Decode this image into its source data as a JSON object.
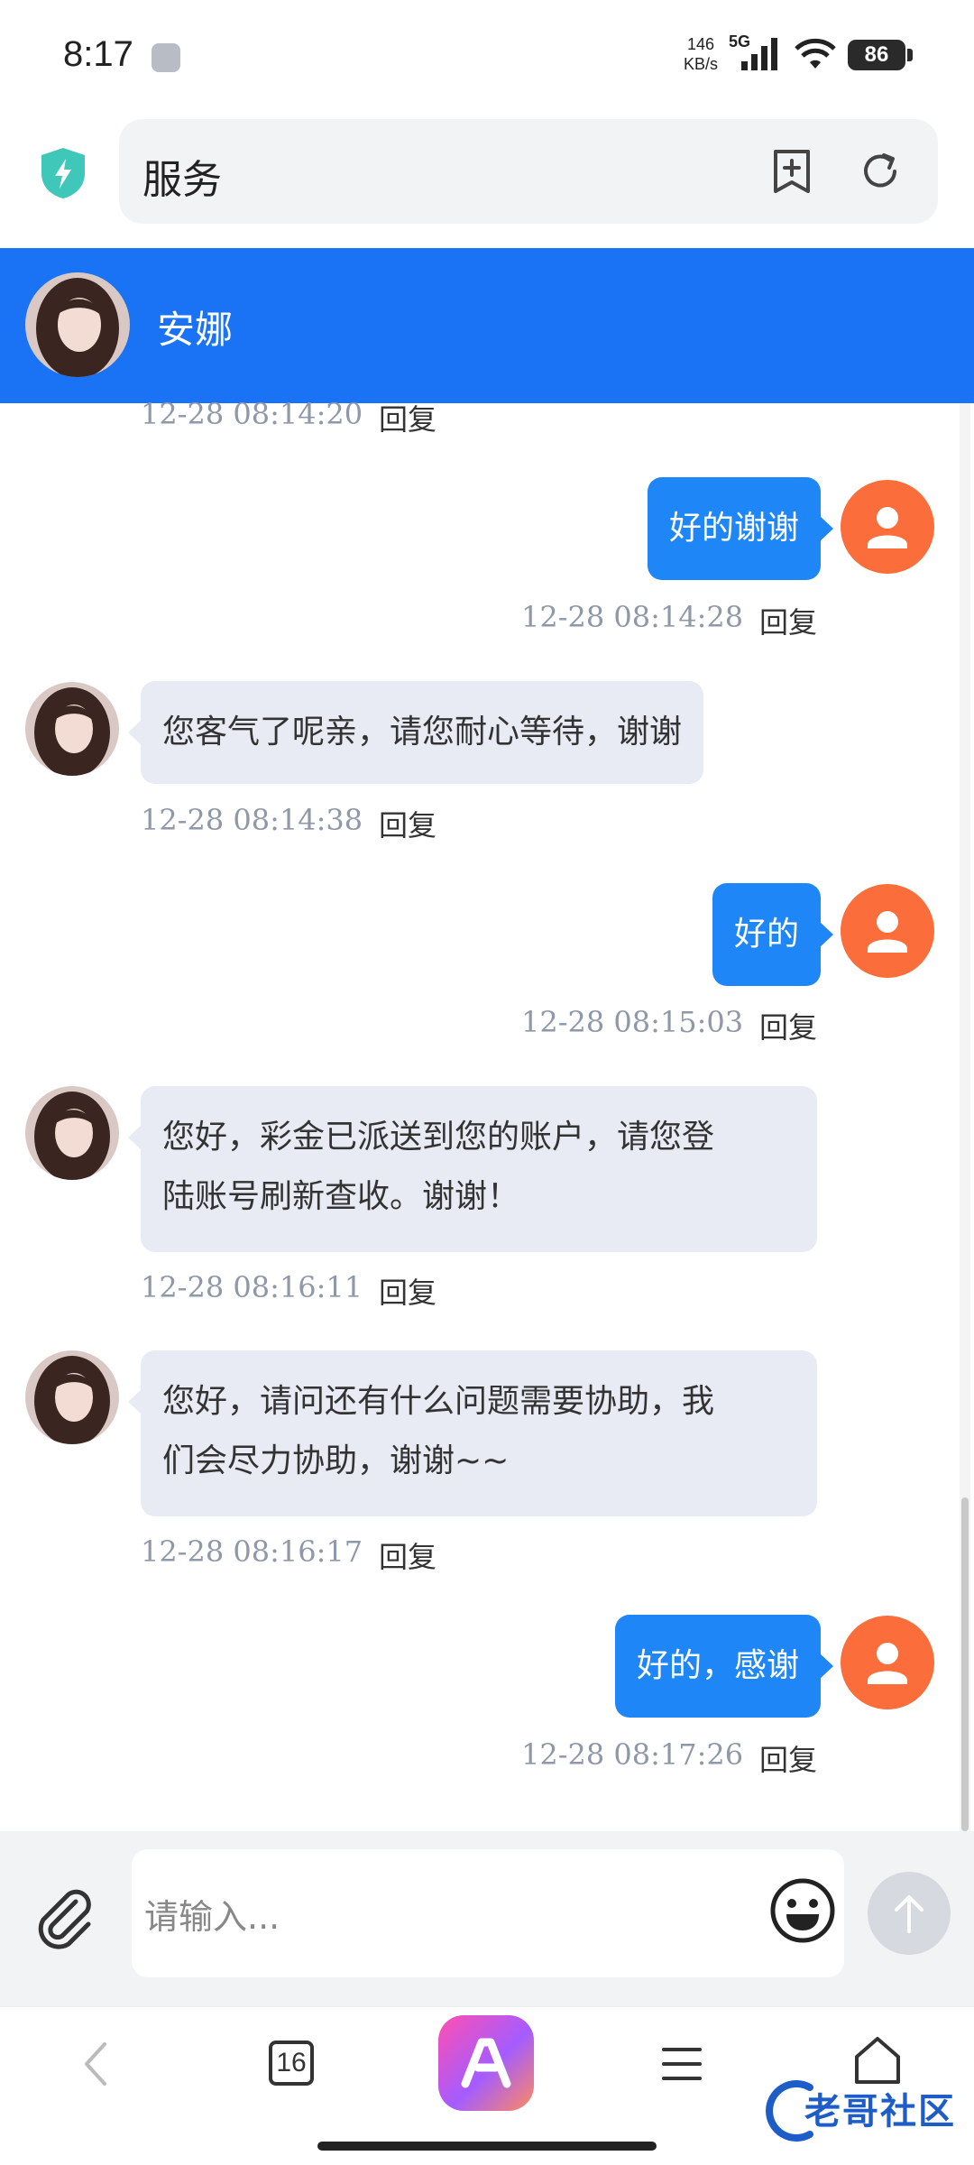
{
  "status_bar": {
    "time": "8:17",
    "speed_value": "146",
    "speed_unit": "KB/s",
    "network": "5G",
    "battery": "86"
  },
  "browser": {
    "url_text": "服务",
    "icons": [
      "shield-icon",
      "add-bookmark-icon",
      "refresh-icon"
    ]
  },
  "chat_header": {
    "name": "安娜"
  },
  "messages": [
    {
      "side": "left",
      "text": "",
      "time": "12-28 08:14:20",
      "reply": "回复"
    },
    {
      "side": "right",
      "text": "好的谢谢",
      "time": "12-28 08:14:28",
      "reply": "回复"
    },
    {
      "side": "left",
      "text": "您客气了呢亲，请您耐心等待，谢谢",
      "time": "12-28 08:14:38",
      "reply": "回复"
    },
    {
      "side": "right",
      "text": "好的",
      "time": "12-28 08:15:03",
      "reply": "回复"
    },
    {
      "side": "left",
      "line1": "您好，彩金已派送到您的账户，请您登",
      "line2": "陆账号刷新查收。谢谢！",
      "time": "12-28 08:16:11",
      "reply": "回复"
    },
    {
      "side": "left",
      "line1": "您好，请问还有什么问题需要协助，我",
      "line2": "们会尽力协助，谢谢~~",
      "time": "12-28 08:16:17",
      "reply": "回复"
    },
    {
      "side": "right",
      "text": "好的，感谢",
      "time": "12-28 08:17:26",
      "reply": "回复"
    }
  ],
  "input": {
    "placeholder": "请输入..."
  },
  "bottom_nav": {
    "tab_count": "16",
    "watermark": "老哥社区"
  },
  "colors": {
    "header_blue": "#1a73f5",
    "bubble_blue": "#1e86f6",
    "bubble_gray": "#e8ebf3",
    "user_avatar": "#fb6d3a"
  }
}
